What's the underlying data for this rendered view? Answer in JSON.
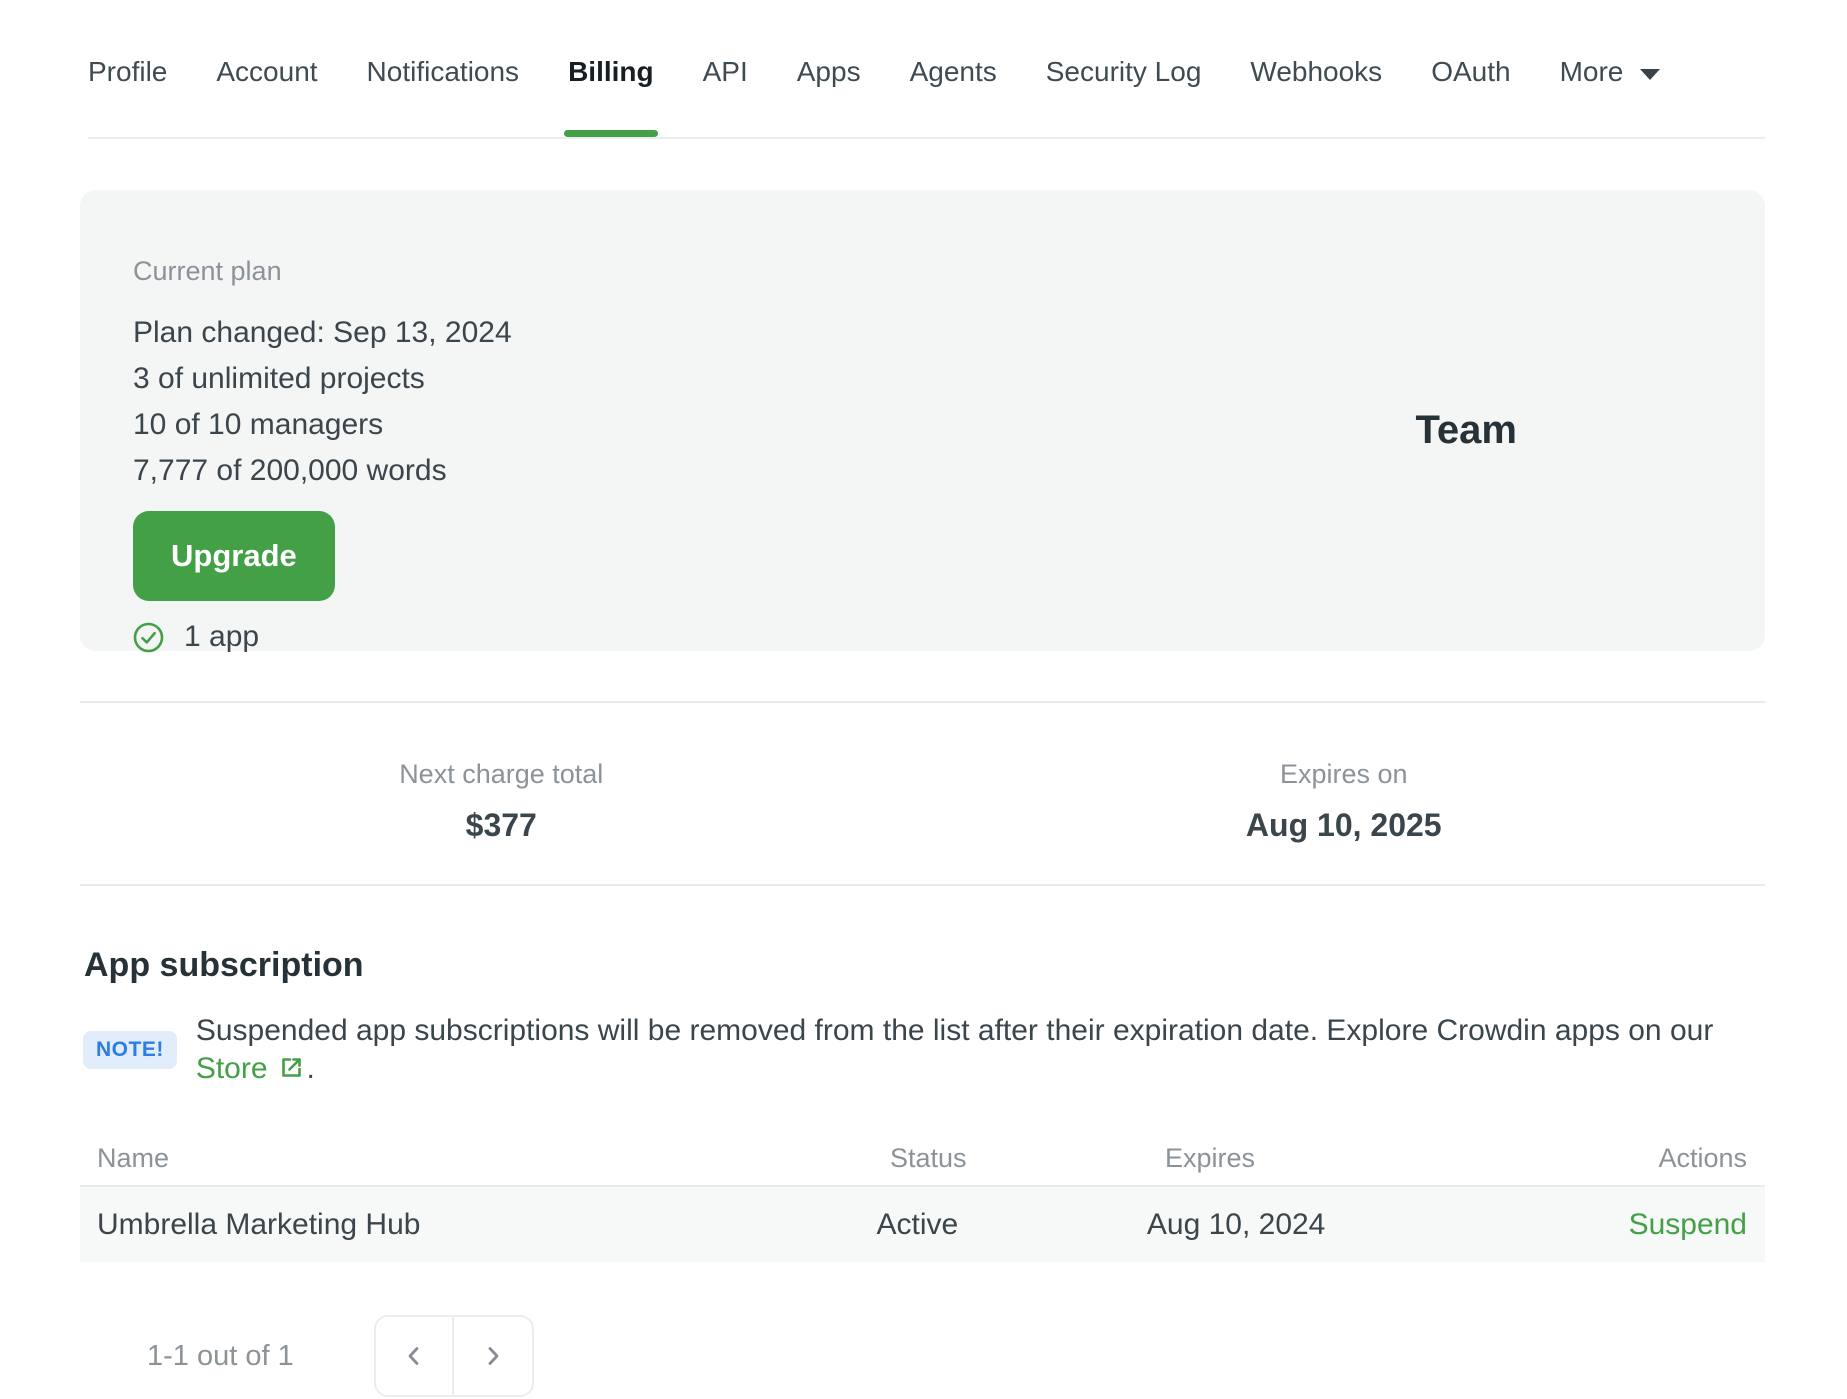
{
  "nav": {
    "tabs": [
      {
        "label": "Profile"
      },
      {
        "label": "Account"
      },
      {
        "label": "Notifications"
      },
      {
        "label": "Billing"
      },
      {
        "label": "API"
      },
      {
        "label": "Apps"
      },
      {
        "label": "Agents"
      },
      {
        "label": "Security Log"
      },
      {
        "label": "Webhooks"
      },
      {
        "label": "OAuth"
      },
      {
        "label": "More"
      }
    ],
    "active_tab": "Billing"
  },
  "plan_card": {
    "label": "Current plan",
    "details": {
      "changed": "Plan changed: Sep 13, 2024",
      "projects": "3 of unlimited projects",
      "managers": "10 of 10 managers",
      "words": "7,777 of 200,000 words"
    },
    "upgrade_label": "Upgrade",
    "apps_count": "1 app",
    "plan_name": "Team"
  },
  "billing_summary": {
    "next_charge": {
      "label": "Next charge total",
      "value": "$377"
    },
    "expires": {
      "label": "Expires on",
      "value": "Aug 10, 2025"
    }
  },
  "app_subscription": {
    "title": "App subscription",
    "note": {
      "badge": "NOTE!",
      "text_before": "Suspended app subscriptions will be removed from the list after their expiration date. Explore Crowdin apps on our",
      "link_label": "Store",
      "text_after": "."
    },
    "table": {
      "headers": {
        "name": "Name",
        "status": "Status",
        "expires": "Expires",
        "actions": "Actions"
      },
      "rows": [
        {
          "name": "Umbrella Marketing Hub",
          "status": "Active",
          "expires": "Aug 10, 2024",
          "action": "Suspend"
        }
      ]
    },
    "pagination": {
      "summary": "1-1 out of 1"
    }
  },
  "colors": {
    "accent_green": "#43a047",
    "card_background": "#f4f5f5",
    "note_badge_bg": "#e2edfc",
    "note_badge_text": "#2c7ee3",
    "muted_text": "#8c9398",
    "body_text": "#3b454c"
  }
}
